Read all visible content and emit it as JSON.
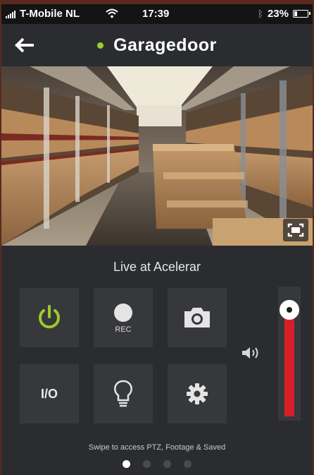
{
  "status_bar": {
    "carrier": "T-Mobile NL",
    "time": "17:39",
    "battery": "23%",
    "battery_level": 0.23
  },
  "header": {
    "title": "Garagedoor",
    "status_color": "#9ccc2a"
  },
  "camera": {
    "caption": "Live at Acelerar"
  },
  "controls": {
    "power_icon": "power-icon",
    "power_color": "#9ccc2a",
    "rec_label": "REC",
    "camera_icon": "camera-icon",
    "io_label": "I/O",
    "light_icon": "lightbulb-icon",
    "settings_icon": "gear-icon"
  },
  "volume": {
    "icon": "speaker-icon",
    "level": 0.85,
    "fill_color": "#d71f2b"
  },
  "footer": {
    "hint": "Swipe to access PTZ, Footage & Saved",
    "page_count": 4,
    "active_page": 1
  }
}
